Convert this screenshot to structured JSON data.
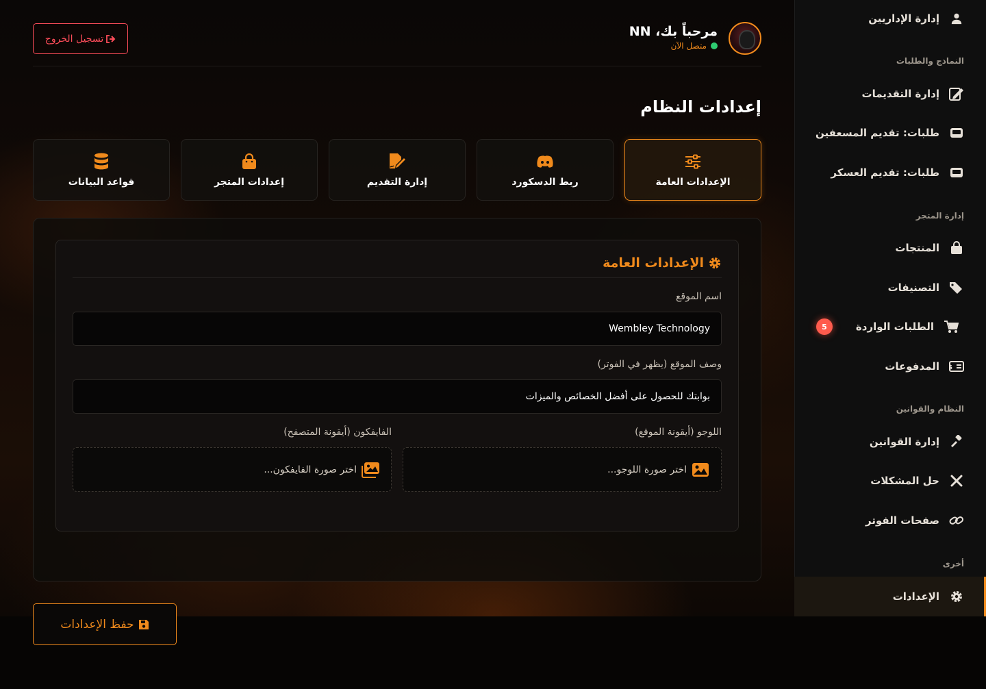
{
  "sidebar": {
    "items": [
      {
        "label": "إدارة الإداريين",
        "icon": "user-icon"
      },
      {
        "label": "إدارة التقديمات",
        "icon": "edit-document-icon"
      },
      {
        "label": "طلبات: تقديم المسعفين",
        "icon": "inbox-icon"
      },
      {
        "label": "طلبات: تقديم العسكر",
        "icon": "inbox-icon"
      },
      {
        "label": "المنتجات",
        "icon": "shopping-bag-icon"
      },
      {
        "label": "التصنيفات",
        "icon": "tags-icon"
      },
      {
        "label": "الطلبات الواردة",
        "icon": "cart-icon",
        "badge": "5"
      },
      {
        "label": "المدفوعات",
        "icon": "money-bill-icon"
      },
      {
        "label": "إدارة القوانين",
        "icon": "gavel-icon"
      },
      {
        "label": "حل المشكلات",
        "icon": "tools-icon"
      },
      {
        "label": "صفحات الفوتر",
        "icon": "link-icon"
      },
      {
        "label": "الإعدادات",
        "icon": "gear-icon"
      }
    ],
    "sections": {
      "forms": "النماذج والطلبات",
      "store": "إدارة المتجر",
      "rules": "النظام والقوانين",
      "other": "أخرى"
    }
  },
  "header": {
    "welcome": "مرحباً بك، NN",
    "status": "متصل الآن",
    "logout_label": "تسجيل الخروج"
  },
  "page": {
    "title": "إعدادات النظام"
  },
  "tabs": [
    {
      "label": "الإعدادات العامة",
      "icon": "sliders-icon",
      "active": true
    },
    {
      "label": "ربط الدسكورد",
      "icon": "discord-icon",
      "active": false
    },
    {
      "label": "إدارة التقديم",
      "icon": "file-signature-icon",
      "active": false
    },
    {
      "label": "إعدادات المتجر",
      "icon": "shopping-bag-icon",
      "active": false
    },
    {
      "label": "قواعد البيانات",
      "icon": "database-icon",
      "active": false
    }
  ],
  "general": {
    "section_title": "الإعدادات العامة",
    "site_name_label": "اسم الموقع",
    "site_name_value": "Wembley Technology",
    "site_desc_label": "وصف الموقع (يظهر في الفوتر)",
    "site_desc_value": "بوابتك للحصول على أفضل الخصائص والميزات",
    "logo_label": "اللوجو (أيقونة الموقع)",
    "logo_placeholder": "اختر صورة اللوجو...",
    "favicon_label": "الفايفكون (أيقونة المتصفح)",
    "favicon_placeholder": "اختر صورة الفايفكون..."
  },
  "actions": {
    "save_label": "حفظ الإعدادات"
  },
  "colors": {
    "accent": "#f08a1c",
    "danger": "#ff4d5a",
    "online": "#2ecc71",
    "badge": "#ff5b4d"
  }
}
